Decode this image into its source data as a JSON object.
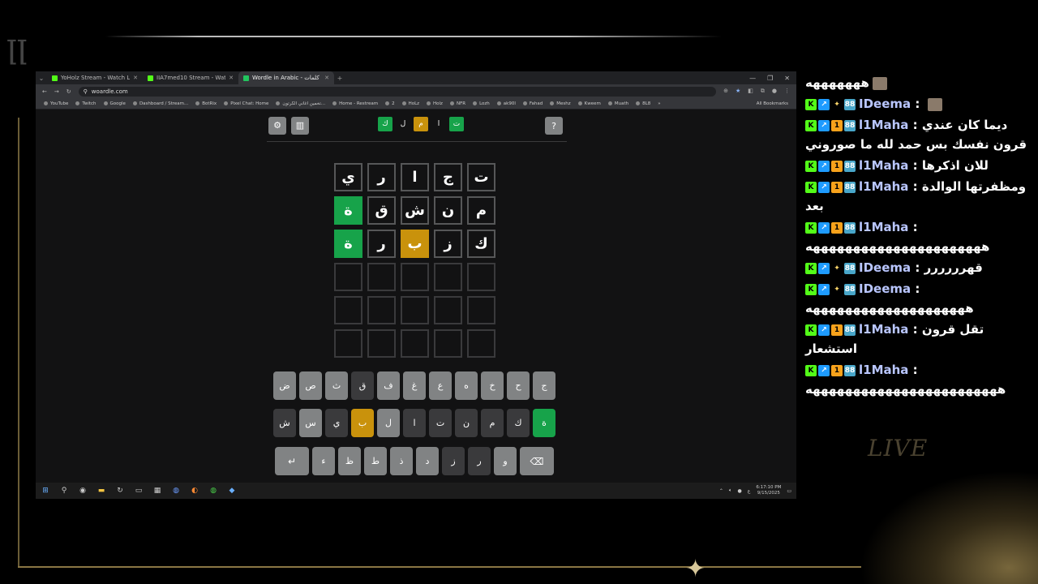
{
  "overlay": {
    "live_label": "LIVE"
  },
  "browser": {
    "tabs": [
      {
        "title": "YoHolz Stream - Watch Live on",
        "favicon": "kick-icon"
      },
      {
        "title": "IIA7med10 Stream - Watch Live",
        "favicon": "kick-icon"
      },
      {
        "title": "Wordle in Arabic - كلمات",
        "favicon": "woardle-icon",
        "active": true
      }
    ],
    "url": "woardle.com",
    "bookmarks": [
      "YouTube",
      "Twitch",
      "Google",
      "Dashboard / Stream...",
      "BotRix",
      "Pixel Chat: Home",
      "تخمين اغاني الكرتون...",
      "Home - Restream",
      "2",
      "HoLz",
      "Holz",
      "NFR",
      "Lozh",
      "ak90l",
      "Fahad",
      "Meshz",
      "Kweem",
      "Muath",
      "8L8"
    ],
    "all_bookmarks": "All Bookmarks"
  },
  "game": {
    "logo": [
      {
        "letter": "ت",
        "state": "green"
      },
      {
        "letter": "ا",
        "state": "plain"
      },
      {
        "letter": "م",
        "state": "yellow"
      },
      {
        "letter": "ل",
        "state": "plain"
      },
      {
        "letter": "ك",
        "state": "green"
      }
    ],
    "help_label": "?",
    "board": [
      [
        {
          "l": "ت",
          "s": "filled"
        },
        {
          "l": "ج",
          "s": "filled"
        },
        {
          "l": "ا",
          "s": "filled"
        },
        {
          "l": "ر",
          "s": "filled"
        },
        {
          "l": "ي",
          "s": "filled"
        }
      ],
      [
        {
          "l": "م",
          "s": "filled"
        },
        {
          "l": "ن",
          "s": "filled"
        },
        {
          "l": "ش",
          "s": "filled"
        },
        {
          "l": "ق",
          "s": "filled"
        },
        {
          "l": "ة",
          "s": "green"
        }
      ],
      [
        {
          "l": "ك",
          "s": "filled"
        },
        {
          "l": "ز",
          "s": "filled"
        },
        {
          "l": "ب",
          "s": "yellow"
        },
        {
          "l": "ر",
          "s": "filled"
        },
        {
          "l": "ة",
          "s": "green"
        }
      ],
      [
        {
          "l": "",
          "s": "empty"
        },
        {
          "l": "",
          "s": "empty"
        },
        {
          "l": "",
          "s": "empty"
        },
        {
          "l": "",
          "s": "empty"
        },
        {
          "l": "",
          "s": "empty"
        }
      ],
      [
        {
          "l": "",
          "s": "empty"
        },
        {
          "l": "",
          "s": "empty"
        },
        {
          "l": "",
          "s": "empty"
        },
        {
          "l": "",
          "s": "empty"
        },
        {
          "l": "",
          "s": "empty"
        }
      ],
      [
        {
          "l": "",
          "s": "empty"
        },
        {
          "l": "",
          "s": "empty"
        },
        {
          "l": "",
          "s": "empty"
        },
        {
          "l": "",
          "s": "empty"
        },
        {
          "l": "",
          "s": "empty"
        }
      ]
    ],
    "keyboard": [
      [
        {
          "l": "ج",
          "s": "normal"
        },
        {
          "l": "ح",
          "s": "normal"
        },
        {
          "l": "خ",
          "s": "normal"
        },
        {
          "l": "ه",
          "s": "normal"
        },
        {
          "l": "ع",
          "s": "normal"
        },
        {
          "l": "غ",
          "s": "normal"
        },
        {
          "l": "ف",
          "s": "normal"
        },
        {
          "l": "ق",
          "s": "used"
        },
        {
          "l": "ث",
          "s": "normal"
        },
        {
          "l": "ص",
          "s": "normal"
        },
        {
          "l": "ض",
          "s": "normal"
        }
      ],
      [
        {
          "l": "ة",
          "s": "green"
        },
        {
          "l": "ك",
          "s": "used"
        },
        {
          "l": "م",
          "s": "used"
        },
        {
          "l": "ن",
          "s": "used"
        },
        {
          "l": "ت",
          "s": "used"
        },
        {
          "l": "ا",
          "s": "used"
        },
        {
          "l": "ل",
          "s": "normal"
        },
        {
          "l": "ب",
          "s": "yellow"
        },
        {
          "l": "ي",
          "s": "used"
        },
        {
          "l": "س",
          "s": "normal"
        },
        {
          "l": "ش",
          "s": "used"
        }
      ],
      [
        {
          "l": "⌫",
          "s": "wide"
        },
        {
          "l": "و",
          "s": "normal"
        },
        {
          "l": "ر",
          "s": "used"
        },
        {
          "l": "ز",
          "s": "used"
        },
        {
          "l": "د",
          "s": "normal"
        },
        {
          "l": "ذ",
          "s": "normal"
        },
        {
          "l": "ط",
          "s": "normal"
        },
        {
          "l": "ظ",
          "s": "normal"
        },
        {
          "l": "ء",
          "s": "normal"
        },
        {
          "l": "↵",
          "s": "wide"
        }
      ]
    ]
  },
  "taskbar": {
    "lang": "ع",
    "time": "6:17:10 PM",
    "date": "9/15/2025"
  },
  "chat": [
    {
      "badges": [],
      "user": "",
      "text": "هههههههه",
      "emote": true
    },
    {
      "badges": [
        "K",
        "↗",
        "✦",
        "88"
      ],
      "user": "IDeema",
      "text": " : ",
      "emote": true
    },
    {
      "badges": [
        "K",
        "↗",
        "1",
        "88"
      ],
      "user": "l1Maha",
      "text": " : ديما كان عندي قرون نفسك بس حمد لله ما صوروني"
    },
    {
      "badges": [
        "K",
        "↗",
        "1",
        "88"
      ],
      "user": "l1Maha",
      "text": " : للان اذكرها"
    },
    {
      "badges": [
        "K",
        "↗",
        "1",
        "88"
      ],
      "user": "l1Maha",
      "text": " : ومظفرتها الوالدة بعد"
    },
    {
      "badges": [
        "K",
        "↗",
        "1",
        "88"
      ],
      "user": "l1Maha",
      "text": " : ههههههههههههههههههههههه"
    },
    {
      "badges": [
        "K",
        "↗",
        "✦",
        "88"
      ],
      "user": "IDeema",
      "text": " : قهرررررر"
    },
    {
      "badges": [
        "K",
        "↗",
        "✦",
        "88"
      ],
      "user": "IDeema",
      "text": " : ههههههههههههههههههههه"
    },
    {
      "badges": [
        "K",
        "↗",
        "1",
        "88"
      ],
      "user": "l1Maha",
      "text": " : تقل قرون استشعار"
    },
    {
      "badges": [
        "K",
        "↗",
        "1",
        "88"
      ],
      "user": "l1Maha",
      "text": " : ههههههههههههههههههههههههه"
    }
  ]
}
